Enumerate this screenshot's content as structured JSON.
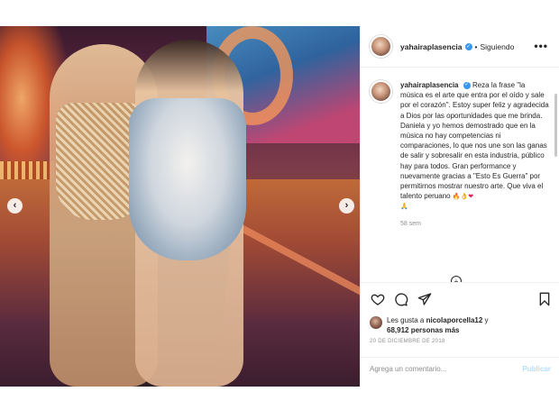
{
  "post": {
    "username": "yahairaplasencia",
    "separator": "•",
    "follow_status": "Siguiendo",
    "more_icon": "more-dots-icon",
    "photo_nav": {
      "prev": "‹",
      "next": "›"
    },
    "caption": {
      "username": "yahairaplasencia",
      "text": "Reza la frase \"la música es el arte que entra por el oído y sale por el corazón\". Estoy super feliz y agradecida a Dios por las oportunidades que me brinda. Daniela y yo hemos demostrado que en la música no hay competencias ni comparaciones, lo que nos une son las ganas de salir y sobresalir en esta industria, público hay para todos. Gran performance y nuevamente gracias a \"Esto Es Guerra\" por permitirnos mostrar nuestro arte. Que viva el talento peruano",
      "emoji_fire": "🔥",
      "emoji_ok": "👌",
      "emoji_heart": "❤",
      "emoji_pray": "🙏",
      "time": "58 sem"
    },
    "load_more": "+",
    "likes": {
      "prefix": "Les gusta a",
      "user": "nicolaporcella12",
      "conj": "y",
      "count_text": "68,912 personas más"
    },
    "date": "20 DE DICIEMBRE DE 2018",
    "comment": {
      "placeholder": "Agrega un comentario...",
      "publish_label": "Publicar"
    }
  }
}
